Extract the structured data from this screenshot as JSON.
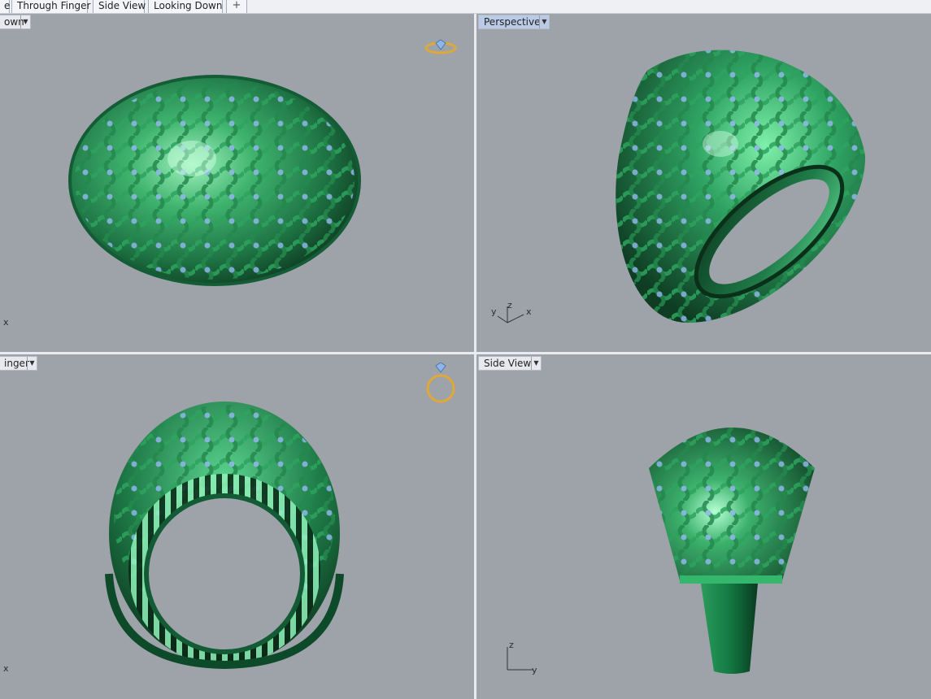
{
  "tabs": [
    {
      "label": "e"
    },
    {
      "label": "Through Finger"
    },
    {
      "label": "Side View"
    },
    {
      "label": "Looking Down"
    }
  ],
  "add_tab_label": "+",
  "viewports": {
    "top_left": {
      "title": "own",
      "axis_x": "x",
      "icon": "ring-top-icon"
    },
    "top_right": {
      "title": "Perspective",
      "axis_x": "x",
      "axis_y": "y",
      "axis_z": "z",
      "active": true
    },
    "bottom_left": {
      "title": "inger",
      "axis_x": "x",
      "icon": "ring-front-icon"
    },
    "bottom_right": {
      "title": "Side View",
      "axis_y": "y",
      "axis_z": "z"
    }
  },
  "colors": {
    "viewport_bg": "#9ea3aa",
    "ring_green": "#1f7a4a",
    "ring_highlight": "#6fe39a",
    "gem_blue": "#8fb6ea",
    "icon_gold": "#e0a838"
  }
}
